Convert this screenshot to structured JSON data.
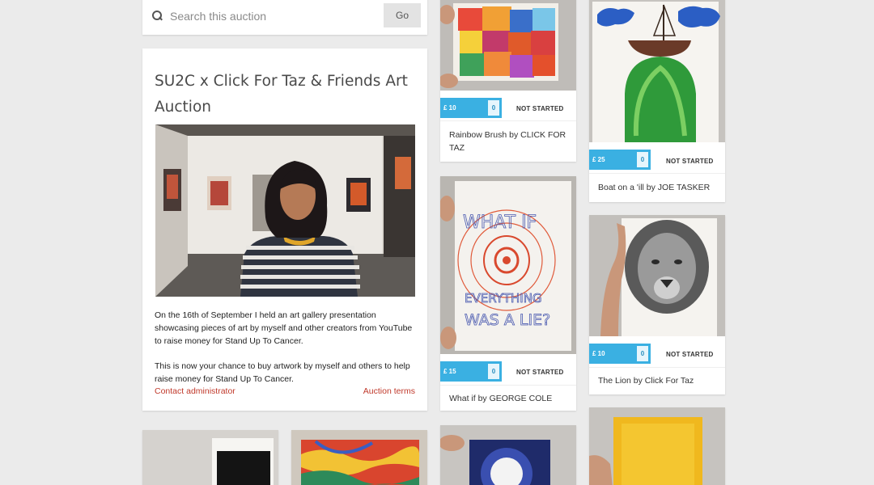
{
  "search": {
    "placeholder": "Search this auction",
    "button": "Go"
  },
  "auction": {
    "title": "SU2C x Click For Taz & Friends Art Auction",
    "paragraph1": "On the 16th of September I held an art gallery presentation showcasing pieces of art by myself and other creators from YouTube to raise money for Stand Up To Cancer.",
    "paragraph2": "This is now your chance to buy artwork by myself and others to help raise money for Stand Up To Cancer.",
    "contact_link": "Contact administrator",
    "terms_link": "Auction terms"
  },
  "lots": [
    {
      "bid": "£ 10",
      "bids": "0",
      "status": "NOT STARTED",
      "title": "Rainbow Brush by CLICK FOR TAZ"
    },
    {
      "bid": "£ 25",
      "bids": "0",
      "status": "NOT STARTED",
      "title": "Boat on a 'ill by JOE TASKER"
    },
    {
      "bid": "£ 15",
      "bids": "0",
      "status": "NOT STARTED",
      "title": "What if by GEORGE COLE"
    },
    {
      "bid": "£ 10",
      "bids": "0",
      "status": "NOT STARTED",
      "title": "The Lion by Click For Taz"
    }
  ],
  "artwork": {
    "what_if_text": [
      "WHAT IF",
      "EVERYTHING",
      "WAS A LIE?"
    ]
  },
  "colors": {
    "bid_badge": "#3ab0e2",
    "link": "#c0392b",
    "background": "#ebebeb"
  }
}
